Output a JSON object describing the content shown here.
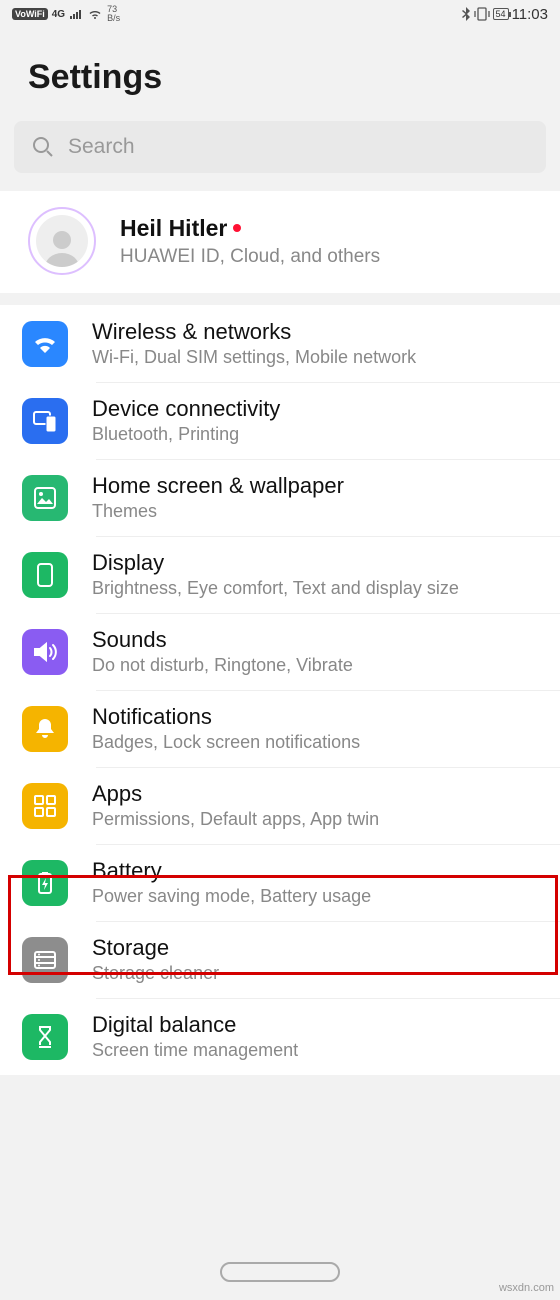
{
  "status": {
    "vowifi": "VoWiFi",
    "net": "4G",
    "speed_top": "73",
    "speed_bot": "B/s",
    "battery": "54",
    "time": "11:03"
  },
  "header": {
    "title": "Settings"
  },
  "search": {
    "placeholder": "Search"
  },
  "account": {
    "name": "Heil Hitler",
    "sub": "HUAWEI ID, Cloud, and others"
  },
  "items": [
    {
      "title": "Wireless & networks",
      "sub": "Wi-Fi, Dual SIM settings, Mobile network",
      "color": "#2a87ff",
      "icon": "wifi-icon"
    },
    {
      "title": "Device connectivity",
      "sub": "Bluetooth, Printing",
      "color": "#2a6ef0",
      "icon": "devices-icon"
    },
    {
      "title": "Home screen & wallpaper",
      "sub": "Themes",
      "color": "#27b872",
      "icon": "wallpaper-icon"
    },
    {
      "title": "Display",
      "sub": "Brightness, Eye comfort, Text and display size",
      "color": "#1db864",
      "icon": "display-icon"
    },
    {
      "title": "Sounds",
      "sub": "Do not disturb, Ringtone, Vibrate",
      "color": "#8a5cf2",
      "icon": "sound-icon"
    },
    {
      "title": "Notifications",
      "sub": "Badges, Lock screen notifications",
      "color": "#f5b400",
      "icon": "bell-icon"
    },
    {
      "title": "Apps",
      "sub": "Permissions, Default apps, App twin",
      "color": "#f5b400",
      "icon": "apps-icon"
    },
    {
      "title": "Battery",
      "sub": "Power saving mode, Battery usage",
      "color": "#1db864",
      "icon": "battery-icon"
    },
    {
      "title": "Storage",
      "sub": "Storage cleaner",
      "color": "#8d8d8d",
      "icon": "storage-icon"
    },
    {
      "title": "Digital balance",
      "sub": "Screen time management",
      "color": "#1db864",
      "icon": "hourglass-icon"
    }
  ],
  "watermark": "wsxdn.com"
}
